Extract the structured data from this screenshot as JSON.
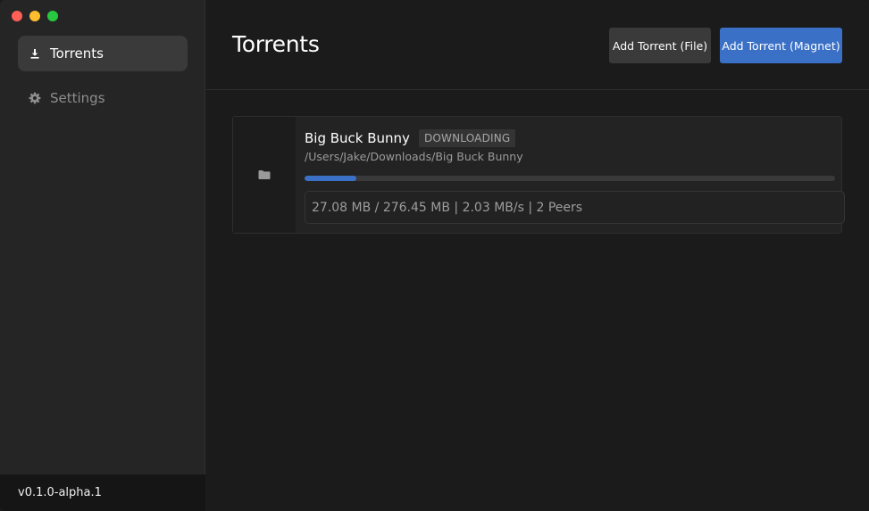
{
  "window": {
    "controls": [
      "close",
      "minimize",
      "maximize"
    ]
  },
  "sidebar": {
    "items": [
      {
        "label": "Torrents",
        "icon": "download-icon",
        "active": true
      },
      {
        "label": "Settings",
        "icon": "gear-icon",
        "active": false
      }
    ],
    "version": "v0.1.0-alpha.1"
  },
  "header": {
    "title": "Torrents",
    "add_file_label": "Add Torrent (File)",
    "add_magnet_label": "Add Torrent (Magnet)"
  },
  "torrents": [
    {
      "name": "Big Buck Bunny",
      "status": "DOWNLOADING",
      "path": "/Users/Jake/Downloads/Big Buck Bunny",
      "icon": "folder-icon",
      "progress": 0.098,
      "stats": "27.08 MB / 276.45 MB | 2.03 MB/s | 2 Peers"
    }
  ],
  "colors": {
    "accent": "#3a70c6",
    "background": "#1b1b1b",
    "sidebar": "#252525"
  }
}
